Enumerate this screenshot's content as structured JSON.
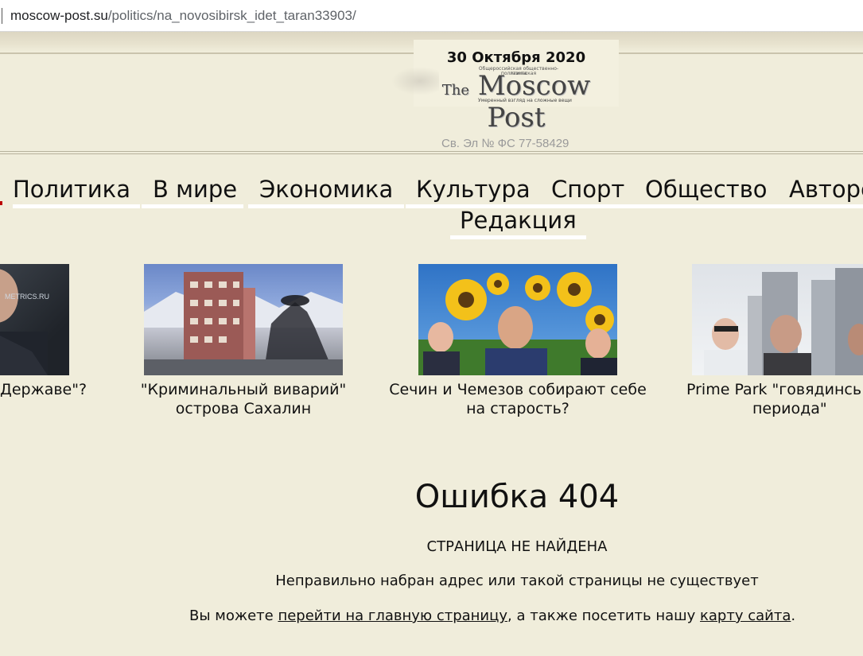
{
  "browser": {
    "url_host": "moscow-post.su",
    "url_path": "/politics/na_novosibirsk_idet_taran33903/"
  },
  "header": {
    "date": "30 Октября 2020",
    "logo_small_line1": "Общероссийская общественно-политическая",
    "logo_small_line2": "газета",
    "logo_the": "The",
    "logo_name": "Moscow Post",
    "tagline": "Умеренный взгляд на сложные вещи",
    "registration": "Св. Эл № ФС 77-58429"
  },
  "nav": {
    "items": [
      "Политика",
      "В мире",
      "Экономика",
      "Культура",
      "Спорт",
      "Общество",
      "Авторс"
    ],
    "second_row": "Редакция"
  },
  "cards": [
    {
      "image_text": "METRICS.RU",
      "title_line1": "Державе\"?",
      "title_line2": ""
    },
    {
      "title_line1": "\"Криминальный виварий\"",
      "title_line2": "острова Сахалин"
    },
    {
      "title_line1": "Сечин и Чемезов собирают себе",
      "title_line2": "на старость?"
    },
    {
      "title_line1": "Prime Park \"говядинсь",
      "title_line2": "периода\""
    }
  ],
  "error": {
    "title": "Ошибка 404",
    "subtitle": "СТРАНИЦА НЕ НАЙДЕНА",
    "description": "Неправильно набран адрес или такой страницы не существует",
    "links_prefix": "Вы можете ",
    "home_link": "перейти на главную страницу",
    "links_middle": ", а также посетить нашу ",
    "sitemap_link": "карту сайта",
    "links_suffix": "."
  },
  "colors": {
    "page_bg": "#f0eddb",
    "nav_underline": "#ffffff"
  }
}
